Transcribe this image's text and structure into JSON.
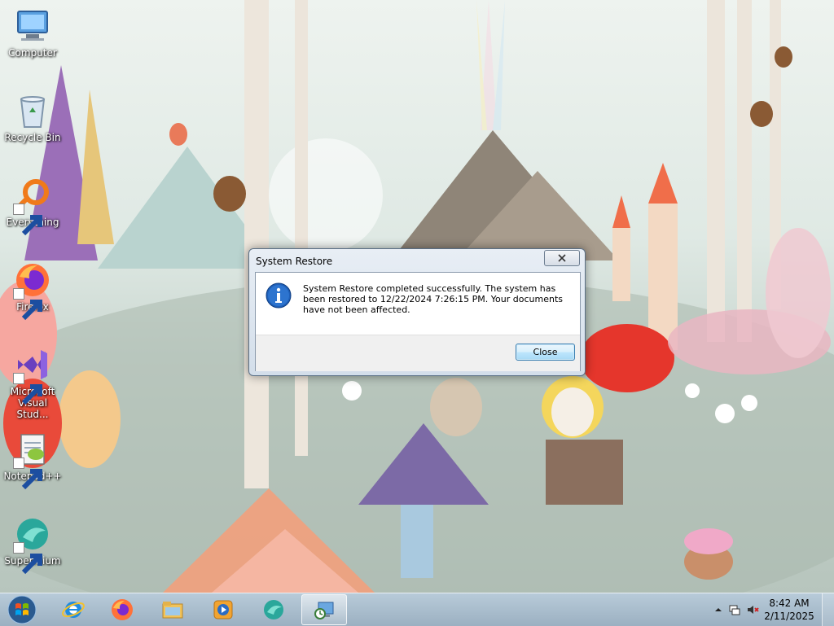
{
  "desktop": {
    "icons": [
      {
        "label": "Computer",
        "icon": "computer-icon"
      },
      {
        "label": "Recycle Bin",
        "icon": "recycle-bin-icon"
      },
      {
        "label": "Everything",
        "icon": "everything-search-icon"
      },
      {
        "label": "Firefox",
        "icon": "firefox-icon"
      },
      {
        "label": "Microsoft Visual Stud...",
        "icon": "visual-studio-icon"
      },
      {
        "label": "Notepad++",
        "icon": "notepadpp-icon"
      },
      {
        "label": "Supermium",
        "icon": "supermium-icon"
      }
    ]
  },
  "dialog": {
    "title": "System Restore",
    "close_icon": "close-icon",
    "icon": "info-icon",
    "message": "System Restore completed successfully. The system has been restored to 12/22/2024 7:26:15 PM. Your documents have not been affected.",
    "button_label": "Close"
  },
  "taskbar": {
    "start_icon": "windows-start-icon",
    "pinned": [
      {
        "icon": "internet-explorer-icon"
      },
      {
        "icon": "firefox-icon"
      },
      {
        "icon": "file-explorer-icon"
      },
      {
        "icon": "media-player-icon"
      },
      {
        "icon": "supermium-icon"
      },
      {
        "icon": "system-restore-icon",
        "active": true
      }
    ],
    "tray": {
      "icons": [
        "show-hidden-icons",
        "network-icon",
        "volume-muted-icon"
      ],
      "time": "8:42 AM",
      "date": "2/11/2025"
    }
  },
  "colors": {
    "button_border": "#3c7fb1",
    "info_blue": "#1e5fb8",
    "firefox_orange": "#ff7139"
  }
}
